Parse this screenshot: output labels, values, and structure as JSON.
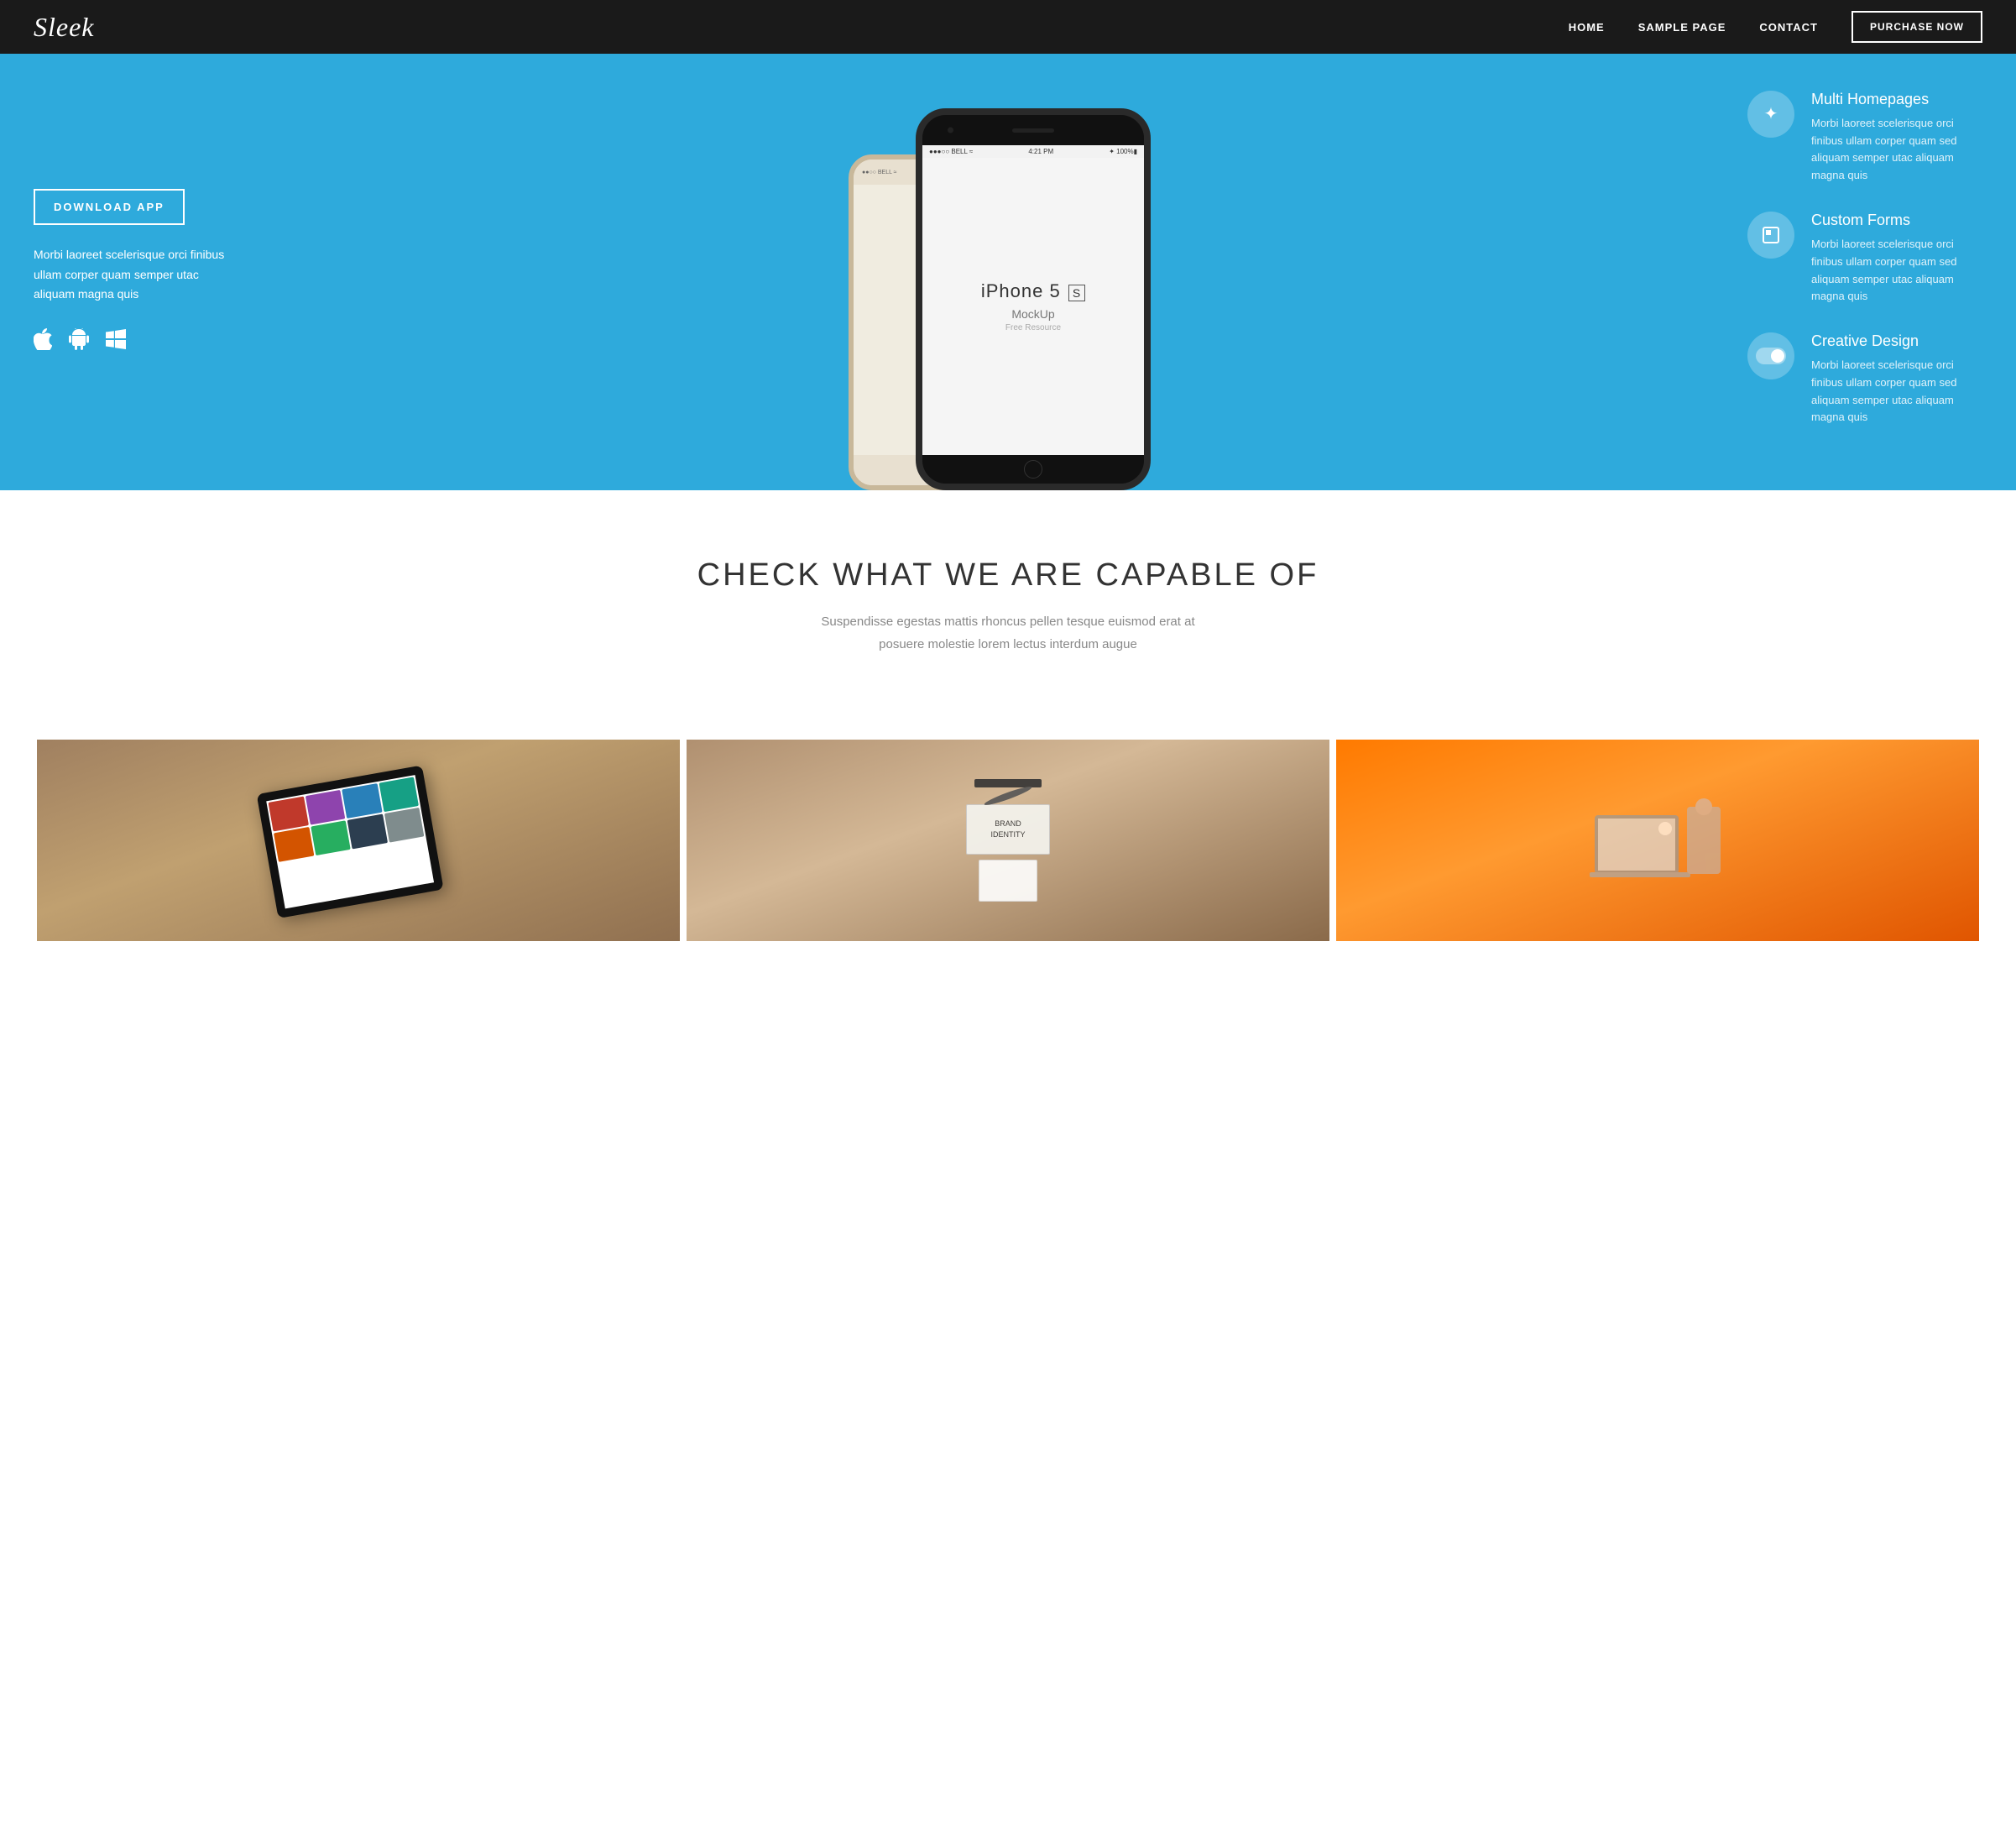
{
  "nav": {
    "logo": "Sleek",
    "links": [
      {
        "label": "HOME",
        "id": "home"
      },
      {
        "label": "SAMPLE PAGE",
        "id": "sample-page"
      },
      {
        "label": "CONTACT",
        "id": "contact"
      }
    ],
    "cta_label": "PURCHASE NOW"
  },
  "hero": {
    "download_btn": "DOWNLOAD APP",
    "description": "Morbi laoreet scelerisque orci finibus ullam corper quam semper utac aliquam magna quis",
    "features": [
      {
        "icon": "✦",
        "title": "Multi Homepages",
        "desc": "Morbi laoreet scelerisque orci finibus ullam corper quam sed aliquam semper utac aliquam magna quis"
      },
      {
        "icon": "▣",
        "title": "Custom Forms",
        "desc": "Morbi laoreet scelerisque orci finibus ullam corper quam sed aliquam semper utac aliquam magna quis"
      },
      {
        "icon": "toggle",
        "title": "Creative Design",
        "desc": "Morbi laoreet scelerisque orci finibus ullam corper quam sed aliquam semper utac aliquam magna quis"
      }
    ],
    "phone": {
      "model": "iPhone 5",
      "suffix": "S",
      "mockup_label": "MockUp",
      "free_label": "Free Resource",
      "status_carrier": "BELL",
      "status_time": "4:21 PM",
      "status_battery": "100%"
    }
  },
  "capable": {
    "title": "CHECK WHAT WE ARE CAPABLE OF",
    "subtitle_line1": "Suspendisse egestas mattis rhoncus pellen tesque euismod erat at",
    "subtitle_line2": "posuere molestie lorem lectus interdum augue"
  },
  "gallery": [
    {
      "id": "tablet",
      "alt": "Tablet with media grid"
    },
    {
      "id": "stationery",
      "alt": "Stationery flat lay"
    },
    {
      "id": "laptop-person",
      "alt": "Person working on laptop"
    }
  ],
  "colors": {
    "hero_bg": "#2eaadc",
    "nav_bg": "#1a1a1a",
    "accent": "#2eaadc",
    "gallery_tablet_bg": "#8B7355",
    "gallery_items_bg": "#C4A882",
    "gallery_laptop_bg": "#FF6B00"
  }
}
